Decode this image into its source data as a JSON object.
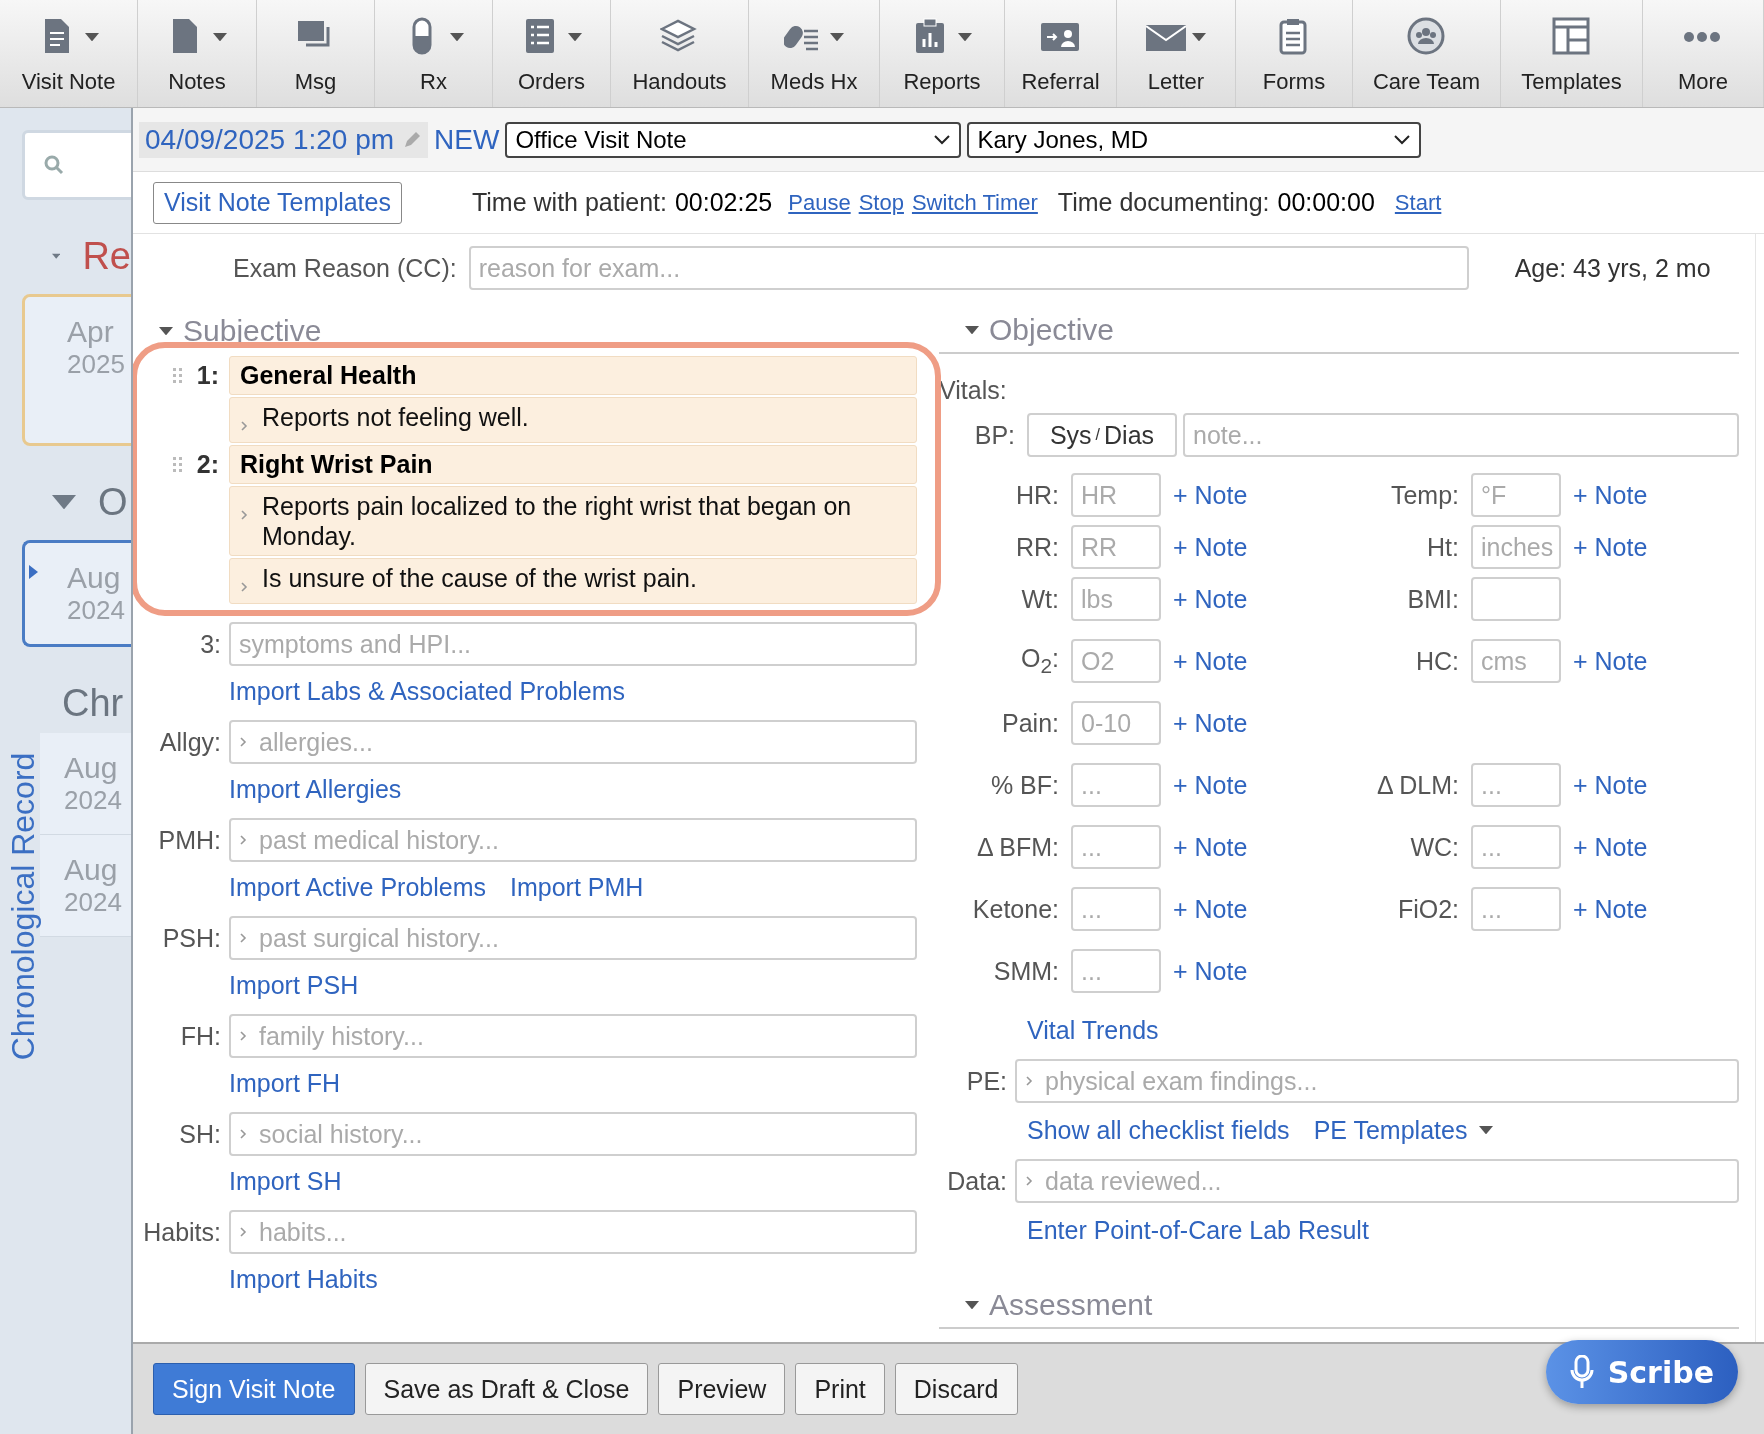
{
  "toolbar": [
    {
      "label": "Visit Note",
      "caret": true
    },
    {
      "label": "Notes",
      "caret": true
    },
    {
      "label": "Msg",
      "caret": false
    },
    {
      "label": "Rx",
      "caret": true
    },
    {
      "label": "Orders",
      "caret": true
    },
    {
      "label": "Handouts",
      "caret": false
    },
    {
      "label": "Meds Hx",
      "caret": true
    },
    {
      "label": "Reports",
      "caret": true
    },
    {
      "label": "Referral",
      "caret": false
    },
    {
      "label": "Letter",
      "caret": true
    },
    {
      "label": "Forms",
      "caret": false
    },
    {
      "label": "Care Team",
      "caret": false
    },
    {
      "label": "Templates",
      "caret": false
    },
    {
      "label": "More",
      "caret": false
    }
  ],
  "sidebar": {
    "sections": [
      {
        "title": "Re",
        "kind": "alert",
        "expanded": true,
        "entries": [
          {
            "date": "Apr",
            "year": "2025",
            "kind": "open"
          }
        ]
      },
      {
        "title": "O",
        "kind": "normal",
        "expanded": true,
        "entries": [
          {
            "date": "Aug",
            "year": "2024",
            "kind": "selected"
          }
        ]
      },
      {
        "title": "Chr",
        "kind": "plain",
        "expanded": false,
        "entries": [
          {
            "date": "Aug",
            "year": "2024",
            "kind": "plain"
          },
          {
            "date": "Aug",
            "year": "2024",
            "kind": "plain"
          }
        ]
      }
    ],
    "vertical_label": "Chronological Record"
  },
  "header": {
    "date": "04/09/2025 1:20 pm",
    "status": "NEW",
    "note_type": "Office Visit Note",
    "provider": "Kary Jones, MD"
  },
  "timer": {
    "templates_button": "Visit Note Templates",
    "patient_label": "Time with patient:",
    "patient_time": "00:02:25",
    "patient_links": [
      "Pause",
      "Stop",
      "Switch Timer"
    ],
    "doc_label": "Time documenting:",
    "doc_time": "00:00:00",
    "doc_link": "Start"
  },
  "exam_reason": {
    "label": "Exam Reason (CC):",
    "placeholder": "reason for exam..."
  },
  "age": "Age: 43 yrs, 2 mo",
  "subjective": {
    "title": "Subjective",
    "expanded": true,
    "highlighted": true,
    "problems": [
      {
        "number": "1:",
        "title": "General Health",
        "items": [
          "Reports not feeling well."
        ]
      },
      {
        "number": "2:",
        "title": "Right Wrist Pain",
        "items": [
          "Reports pain localized to the right wrist that began on Monday.",
          "Is unsure of the cause of the wrist pain."
        ]
      }
    ],
    "hpi": {
      "label": "3:",
      "placeholder": "symptoms and HPI...",
      "links": [
        "Import Labs & Associated Problems"
      ]
    },
    "fields": [
      {
        "label": "Allgy:",
        "placeholder": "allergies...",
        "links": [
          "Import Allergies"
        ]
      },
      {
        "label": "PMH:",
        "placeholder": "past medical history...",
        "links": [
          "Import Active Problems",
          "Import PMH"
        ]
      },
      {
        "label": "PSH:",
        "placeholder": "past surgical history...",
        "links": [
          "Import PSH"
        ]
      },
      {
        "label": "FH:",
        "placeholder": "family history...",
        "links": [
          "Import FH"
        ]
      },
      {
        "label": "SH:",
        "placeholder": "social history...",
        "links": [
          "Import SH"
        ]
      },
      {
        "label": "Habits:",
        "placeholder": "habits...",
        "links": [
          "Import Habits"
        ]
      }
    ]
  },
  "objective": {
    "title": "Objective",
    "expanded": true,
    "vitals_label": "Vitals:",
    "bp": {
      "label": "BP:",
      "sys": "Sys",
      "separator": "/",
      "dias": "Dias",
      "note_placeholder": "note..."
    },
    "rows": [
      {
        "left": {
          "label": "HR:",
          "placeholder": "HR",
          "note": "+ Note"
        },
        "right": {
          "label": "Temp:",
          "placeholder": "°F",
          "note": "+ Note"
        }
      },
      {
        "left": {
          "label": "RR:",
          "placeholder": "RR",
          "note": "+ Note"
        },
        "right": {
          "label": "Ht:",
          "placeholder": "inches",
          "note": "+ Note"
        }
      },
      {
        "left": {
          "label": "Wt:",
          "placeholder": "lbs",
          "note": "+ Note"
        },
        "right": {
          "label": "BMI:"
        }
      },
      {
        "left": {
          "label": "O$_{2}$:",
          "placeholder": "O2",
          "note": "+ Note"
        },
        "right": {
          "label": "HC:",
          "placeholder": "cms",
          "note": "+ Note"
        }
      },
      {
        "left": {
          "label": "Pain:",
          "placeholder": "0-10",
          "note": "+ Note"
        }
      },
      {
        "left": {
          "label": "% BF:",
          "placeholder": "...",
          "note": "+ Note"
        },
        "right": {
          "label": "Δ DLM:",
          "placeholder": "...",
          "note": "+ Note"
        }
      },
      {
        "left": {
          "label": "Δ BFM:",
          "placeholder": "...",
          "note": "+ Note"
        },
        "right": {
          "label": "WC:",
          "placeholder": "...",
          "note": "+ Note"
        }
      },
      {
        "left": {
          "label": "Ketone:",
          "placeholder": "...",
          "note": "+ Note"
        },
        "right": {
          "label": "FiO2:",
          "placeholder": "...",
          "note": "+ Note"
        }
      },
      {
        "left": {
          "label": "SMM:",
          "placeholder": "...",
          "note": "+ Note"
        }
      }
    ],
    "trends_link": "Vital Trends",
    "fields": [
      {
        "label": "PE:",
        "placeholder": "physical exam findings...",
        "links": [
          {
            "text": "Show all checklist fields",
            "caret": false
          },
          {
            "text": "PE Templates",
            "caret": true
          }
        ]
      },
      {
        "label": "Data:",
        "placeholder": "data reviewed...",
        "links": [
          {
            "text": "Enter Point-of-Care Lab Result",
            "caret": false
          }
        ]
      }
    ]
  },
  "assessment": {
    "title": "Assessment",
    "expanded": true
  },
  "footer": {
    "buttons": [
      {
        "label": "Sign Visit Note",
        "kind": "primary"
      },
      {
        "label": "Save as Draft & Close",
        "kind": "default"
      },
      {
        "label": "Preview",
        "kind": "default"
      },
      {
        "label": "Print",
        "kind": "default"
      },
      {
        "label": "Discard",
        "kind": "default"
      }
    ]
  },
  "scribe": "Scribe"
}
